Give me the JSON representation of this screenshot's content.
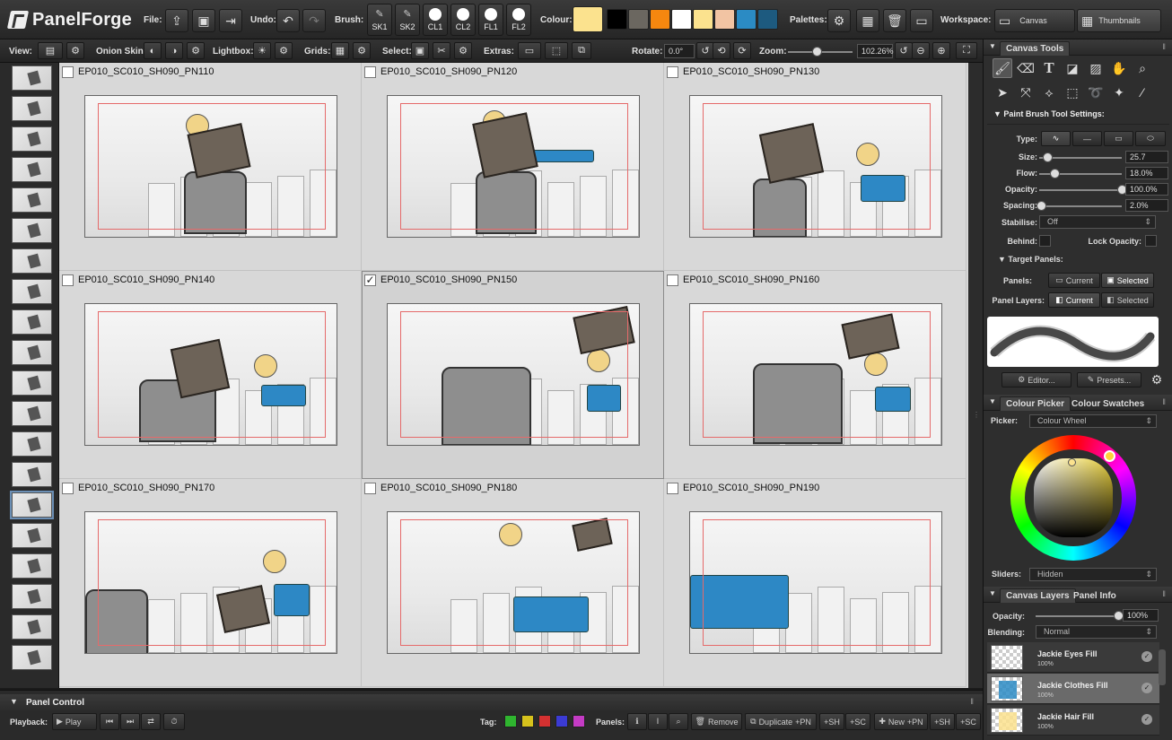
{
  "app": {
    "name": "PanelForge"
  },
  "topbar": {
    "file_label": "File:",
    "undo_label": "Undo:",
    "brush_label": "Brush:",
    "brushes": [
      {
        "label": "SK1",
        "icon": "pencil-icon"
      },
      {
        "label": "SK2",
        "icon": "pencil-icon"
      },
      {
        "label": "CL1",
        "icon": "dot-icon"
      },
      {
        "label": "CL2",
        "icon": "dot-icon"
      },
      {
        "label": "FL1",
        "icon": "dot-icon"
      },
      {
        "label": "FL2",
        "icon": "dot-icon"
      }
    ],
    "colour_label": "Colour:",
    "current_colour": "#fbe28e",
    "swatches": [
      "#000000",
      "#6b6760",
      "#f5870f",
      "#ffffff",
      "#fbe28e",
      "#f2c4a3",
      "#2b8bc4",
      "#1d5a7f"
    ],
    "palettes_label": "Palettes:",
    "workspace_label": "Workspace:",
    "workspace_canvas": "Canvas",
    "workspace_thumbnails": "Thumbnails"
  },
  "toolbar2": {
    "view_label": "View:",
    "onion_label": "Onion Skin:",
    "lightbox_label": "Lightbox:",
    "grids_label": "Grids:",
    "select_label": "Select:",
    "extras_label": "Extras:",
    "rotate_label": "Rotate:",
    "rotate_value": "0.0°",
    "zoom_label": "Zoom:",
    "zoom_value": "102.26%",
    "zoom_fraction": 0.45
  },
  "panels": [
    {
      "name": "EP010_SC010_SH090_PN110",
      "checked": false
    },
    {
      "name": "EP010_SC010_SH090_PN120",
      "checked": false
    },
    {
      "name": "EP010_SC010_SH090_PN130",
      "checked": false
    },
    {
      "name": "EP010_SC010_SH090_PN140",
      "checked": false
    },
    {
      "name": "EP010_SC010_SH090_PN150",
      "checked": true
    },
    {
      "name": "EP010_SC010_SH090_PN160",
      "checked": false
    },
    {
      "name": "EP010_SC010_SH090_PN170",
      "checked": false
    },
    {
      "name": "EP010_SC010_SH090_PN180",
      "checked": false
    },
    {
      "name": "EP010_SC010_SH090_PN190",
      "checked": false
    }
  ],
  "panel_control": {
    "title": "Panel Control",
    "playback_label": "Playback:",
    "play_label": "Play",
    "tag_label": "Tag:",
    "tag_colors": [
      "#2fb52f",
      "#d6c21c",
      "#d43131",
      "#3b3bd4",
      "#c43bc4"
    ],
    "panels_label": "Panels:",
    "remove_label": "Remove",
    "duplicate_label": "Duplicate",
    "pn_label": "+PN",
    "sh_label": "+SH",
    "sc_label": "+SC",
    "new_label": "New"
  },
  "canvas_tools": {
    "title": "Canvas Tools",
    "settings_title": "Paint Brush Tool Settings:",
    "type_label": "Type:",
    "size_label": "Size:",
    "size_value": "25.7",
    "size_fraction": 0.1,
    "flow_label": "Flow:",
    "flow_value": "18.0%",
    "flow_fraction": 0.18,
    "opacity_label": "Opacity:",
    "opacity_value": "100.0%",
    "opacity_fraction": 1.0,
    "spacing_label": "Spacing:",
    "spacing_value": "2.0%",
    "spacing_fraction": 0.02,
    "stabilise_label": "Stabilise:",
    "stabilise_value": "Off",
    "behind_label": "Behind:",
    "lock_opacity_label": "Lock Opacity:",
    "target_panels_label": "Target Panels:",
    "panels_label": "Panels:",
    "panel_layers_label": "Panel Layers:",
    "current_label": "Current",
    "selected_label": "Selected",
    "editor_label": "Editor...",
    "presets_label": "Presets..."
  },
  "colour": {
    "tab_picker": "Colour Picker",
    "tab_swatches": "Colour Swatches",
    "picker_label": "Picker:",
    "picker_value": "Colour Wheel",
    "sliders_label": "Sliders:",
    "sliders_value": "Hidden"
  },
  "layers": {
    "tab_layers": "Canvas Layers",
    "tab_info": "Panel Info",
    "opacity_label": "Opacity:",
    "opacity_value": "100%",
    "opacity_fraction": 1.0,
    "blending_label": "Blending:",
    "blending_value": "Normal",
    "items": [
      {
        "name": "Jackie Eyes Fill",
        "opacity": "100%"
      },
      {
        "name": "Jackie Clothes Fill",
        "opacity": "100%"
      },
      {
        "name": "Jackie Hair Fill",
        "opacity": "100%"
      }
    ]
  }
}
